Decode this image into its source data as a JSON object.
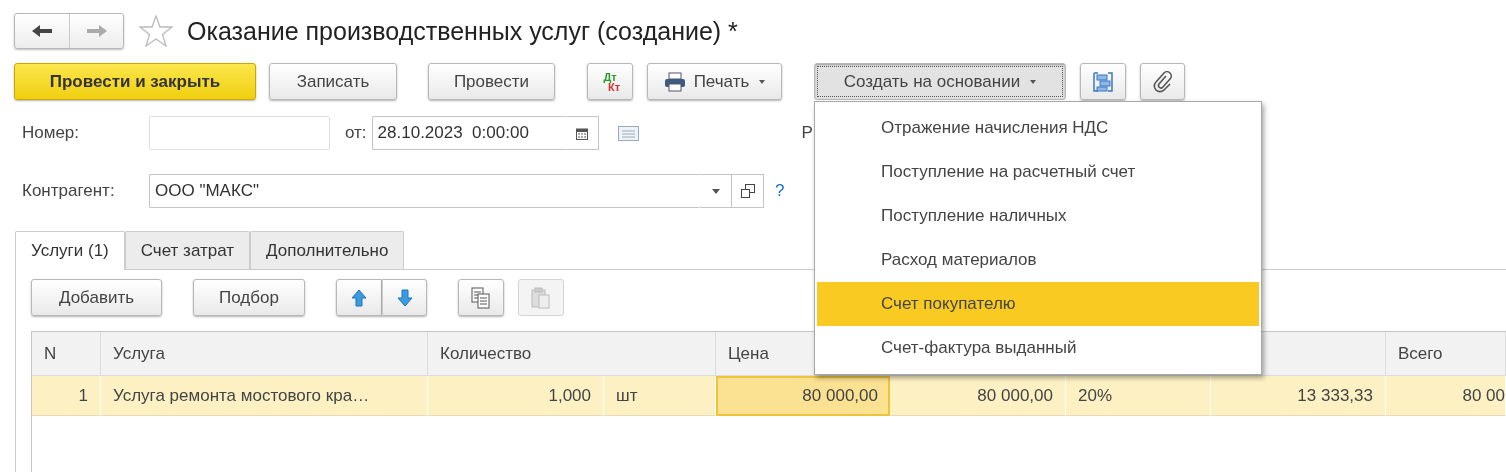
{
  "window": {
    "title": "Оказание производственных услуг (создание) *"
  },
  "toolbar": [
    {
      "kind": "primary",
      "label": "Провести и закрыть"
    },
    {
      "kind": "default",
      "label": "Записать"
    },
    {
      "kind": "default",
      "label": "Провести"
    },
    {
      "kind": "dtkt",
      "label_top": "Дт",
      "label_bottom": "Кт"
    },
    {
      "kind": "print",
      "label": "Печать"
    },
    {
      "kind": "menu",
      "label": "Создать на основании",
      "pressed": true
    },
    {
      "kind": "structure"
    },
    {
      "kind": "attach"
    }
  ],
  "form": {
    "number": {
      "label": "Номер:"
    },
    "date": {
      "label": "от:",
      "value": "28.10.2023  0:00:00"
    },
    "hidden_label": "Р",
    "counterparty": {
      "label": "Контрагент:",
      "value": "ООО \"МАКС\"",
      "help": "?"
    }
  },
  "tabs": [
    {
      "label": "Услуги (1)",
      "selected": true
    },
    {
      "label": "Счет затрат",
      "selected": false
    },
    {
      "label": "Дополнительно",
      "selected": false
    }
  ],
  "table_toolbar": [
    {
      "kind": "text",
      "label": "Добавить",
      "disabled": false
    },
    {
      "kind": "text",
      "label": "Подбор",
      "disabled": false
    },
    {
      "kind": "up",
      "disabled": false
    },
    {
      "kind": "down",
      "disabled": false
    },
    {
      "kind": "copy",
      "disabled": false
    },
    {
      "kind": "paste",
      "disabled": true
    }
  ],
  "table": {
    "columns": [
      "N",
      "Услуга",
      "Количество",
      "Цена",
      "Всего"
    ],
    "rows": [
      {
        "selected": true,
        "cells": [
          {
            "text": "1",
            "selected": false
          },
          {
            "text": "Услуга ремонта мостового кра…",
            "selected": false
          },
          {
            "text": "1,000",
            "selected": false
          },
          {
            "text": "шт",
            "selected": false
          },
          {
            "text": "80 000,00",
            "selected": true
          },
          {
            "text": "80 000,00",
            "selected": false
          },
          {
            "text": "20%",
            "selected": false
          },
          {
            "text": "13 333,33",
            "selected": false
          },
          {
            "text": "80 00",
            "selected": false
          }
        ]
      }
    ]
  },
  "menu": {
    "items": [
      {
        "label": "Отражение начисления НДС",
        "selected": false
      },
      {
        "label": "Поступление на расчетный счет",
        "selected": false
      },
      {
        "label": "Поступление наличных",
        "selected": false
      },
      {
        "label": "Расход материалов",
        "selected": false
      },
      {
        "label": "Счет покупателю",
        "selected": true
      },
      {
        "label": "Счет-фактура выданный",
        "selected": false
      }
    ]
  }
}
